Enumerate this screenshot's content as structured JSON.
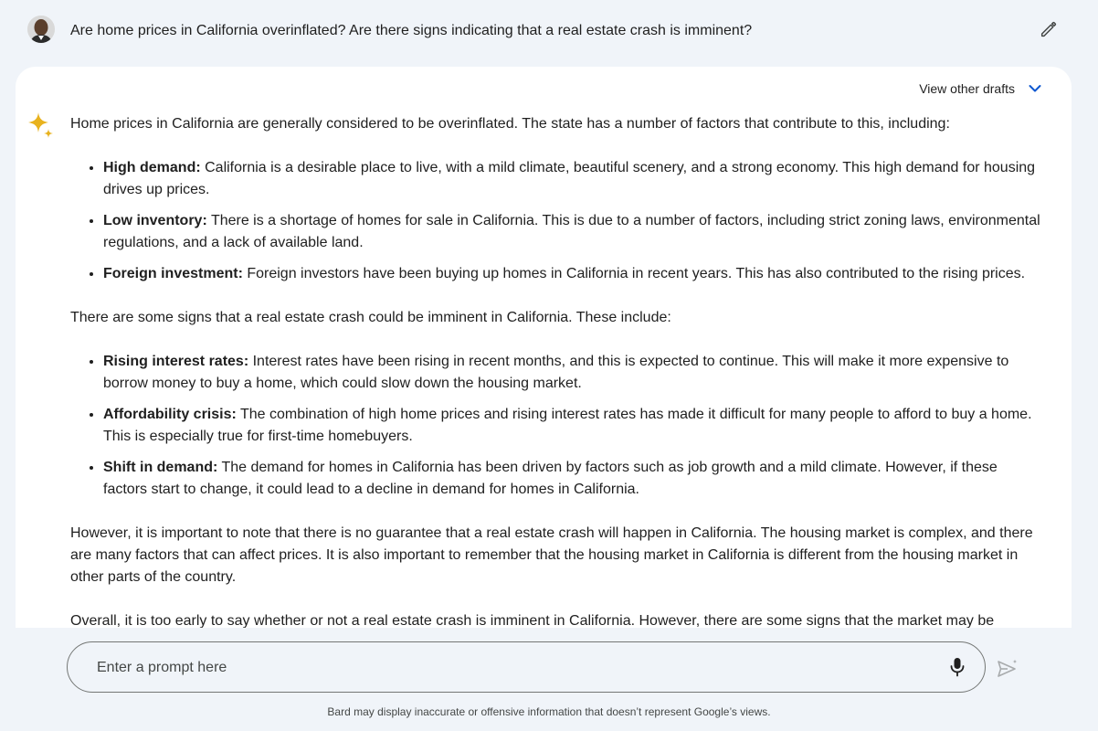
{
  "prompt": {
    "text": "Are home prices in California overinflated? Are there signs indicating that a real estate crash is imminent?"
  },
  "response": {
    "drafts_label": "View other drafts",
    "intro": "Home prices in California are generally considered to be overinflated. The state has a number of factors that contribute to this, including:",
    "factors": [
      {
        "term": "High demand:",
        "text": " California is a desirable place to live, with a mild climate, beautiful scenery, and a strong economy. This high demand for housing drives up prices."
      },
      {
        "term": "Low inventory:",
        "text": " There is a shortage of homes for sale in California. This is due to a number of factors, including strict zoning laws, environmental regulations, and a lack of available land."
      },
      {
        "term": "Foreign investment:",
        "text": " Foreign investors have been buying up homes in California in recent years. This has also contributed to the rising prices."
      }
    ],
    "signs_intro": "There are some signs that a real estate crash could be imminent in California. These include:",
    "signs": [
      {
        "term": "Rising interest rates:",
        "text": " Interest rates have been rising in recent months, and this is expected to continue. This will make it more expensive to borrow money to buy a home, which could slow down the housing market."
      },
      {
        "term": "Affordability crisis:",
        "text": " The combination of high home prices and rising interest rates has made it difficult for many people to afford to buy a home. This is especially true for first-time homebuyers."
      },
      {
        "term": "Shift in demand:",
        "text": " The demand for homes in California has been driven by factors such as job growth and a mild climate. However, if these factors start to change, it could lead to a decline in demand for homes in California."
      }
    ],
    "caveat": "However, it is important to note that there is no guarantee that a real estate crash will happen in California. The housing market is complex, and there are many factors that can affect prices. It is also important to remember that the housing market in California is different from the housing market in other parts of the country.",
    "overall": "Overall, it is too early to say whether or not a real estate crash is imminent in California. However, there are some signs that the market may be"
  },
  "input": {
    "placeholder": "Enter a prompt here"
  },
  "footer": {
    "disclaimer": "Bard may display inaccurate or offensive information that doesn’t represent Google’s views."
  },
  "colors": {
    "page_bg": "#f0f4f9",
    "card_bg": "#ffffff",
    "accent_blue": "#0b57d0",
    "sparkle_gold": "#e8b21e"
  },
  "icons": {
    "edit": "pencil-icon",
    "drafts": "chevron-down-icon",
    "assistant": "sparkle-icon",
    "mic": "microphone-icon",
    "send": "send-icon"
  }
}
